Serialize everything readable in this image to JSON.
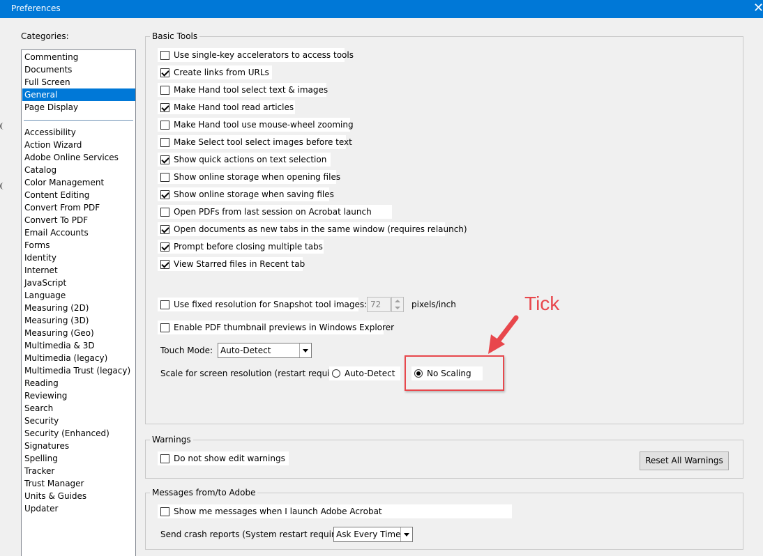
{
  "window": {
    "title": "Preferences",
    "close_glyph": "✕"
  },
  "categories": {
    "label": "Categories:",
    "top_items": [
      "Commenting",
      "Documents",
      "Full Screen",
      "General",
      "Page Display"
    ],
    "selected": "General",
    "items": [
      "Accessibility",
      "Action Wizard",
      "Adobe Online Services",
      "Catalog",
      "Color Management",
      "Content Editing",
      "Convert From PDF",
      "Convert To PDF",
      "Email Accounts",
      "Forms",
      "Identity",
      "Internet",
      "JavaScript",
      "Language",
      "Measuring (2D)",
      "Measuring (3D)",
      "Measuring (Geo)",
      "Multimedia & 3D",
      "Multimedia (legacy)",
      "Multimedia Trust (legacy)",
      "Reading",
      "Reviewing",
      "Search",
      "Security",
      "Security (Enhanced)",
      "Signatures",
      "Spelling",
      "Tracker",
      "Trust Manager",
      "Units & Guides",
      "Updater"
    ]
  },
  "basic_tools": {
    "title": "Basic Tools",
    "options": [
      {
        "label": "Use single-key accelerators to access tools",
        "checked": false
      },
      {
        "label": "Create links from URLs",
        "checked": true
      },
      {
        "label": "Make Hand tool select text & images",
        "checked": false
      },
      {
        "label": "Make Hand tool read articles",
        "checked": true
      },
      {
        "label": "Make Hand tool use mouse-wheel zooming",
        "checked": false
      },
      {
        "label": "Make Select tool select images before text",
        "checked": false
      },
      {
        "label": "Show quick actions on text selection",
        "checked": true
      },
      {
        "label": "Show online storage when opening files",
        "checked": false
      },
      {
        "label": "Show online storage when saving files",
        "checked": true
      },
      {
        "label": "Open PDFs from last session on Acrobat launch",
        "checked": false
      },
      {
        "label": "Open documents as new tabs in the same window (requires relaunch)",
        "checked": true
      },
      {
        "label": "Prompt before closing multiple tabs",
        "checked": true
      },
      {
        "label": "View Starred files in Recent tab",
        "checked": true
      }
    ],
    "snapshot": {
      "label": "Use fixed resolution for Snapshot tool images:",
      "checked": false,
      "value": "72",
      "unit": "pixels/inch"
    },
    "thumbnail": {
      "label": "Enable PDF thumbnail previews in Windows Explorer",
      "checked": false
    },
    "touch_mode": {
      "label": "Touch Mode:",
      "value": "Auto-Detect"
    },
    "scale": {
      "label": "Scale for screen resolution (restart required):",
      "options": [
        "Auto-Detect",
        "No Scaling"
      ],
      "selected": "No Scaling"
    }
  },
  "warnings": {
    "title": "Warnings",
    "option": {
      "label": "Do not show edit warnings",
      "checked": false
    },
    "reset_button": "Reset All Warnings"
  },
  "messages": {
    "title": "Messages from/to Adobe",
    "option": {
      "label": "Show me messages when I launch Adobe Acrobat",
      "checked": false
    },
    "crash_label": "Send crash reports (System restart required):",
    "crash_value": "Ask Every Time"
  },
  "annotation": {
    "text": "Tick",
    "color": "#e8474c"
  },
  "colors": {
    "accent": "#0078d7",
    "selection": "#0078d7"
  }
}
